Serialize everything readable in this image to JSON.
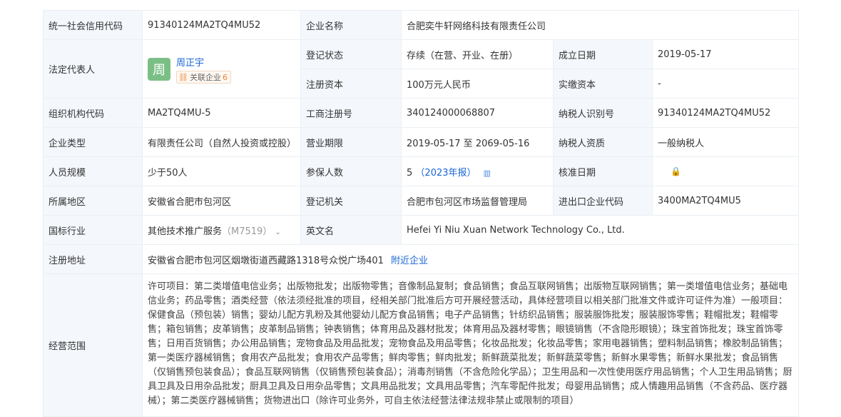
{
  "rows": {
    "credit_code": {
      "label": "统一社会信用代码",
      "value": "91340124MA2TQ4MU52"
    },
    "company_name": {
      "label": "企业名称",
      "value": "合肥奕牛轩网络科技有限责任公司"
    },
    "legal_rep": {
      "label": "法定代表人",
      "avatar_char": "周",
      "name": "周正宇",
      "related_label": "关联企业",
      "related_count": "6"
    },
    "reg_status": {
      "label": "登记状态",
      "value": "存续（在营、开业、在册）"
    },
    "est_date": {
      "label": "成立日期",
      "value": "2019-05-17"
    },
    "reg_capital": {
      "label": "注册资本",
      "value": "100万元人民币"
    },
    "paid_capital": {
      "label": "实缴资本",
      "value": "-"
    },
    "org_code": {
      "label": "组织机构代码",
      "value": "MA2TQ4MU-5"
    },
    "biz_reg_no": {
      "label": "工商注册号",
      "value": "340124000068807"
    },
    "taxpayer_id": {
      "label": "纳税人识别号",
      "value": "91340124MA2TQ4MU52"
    },
    "company_type": {
      "label": "企业类型",
      "value": "有限责任公司（自然人投资或控股）"
    },
    "biz_term": {
      "label": "营业期限",
      "value": "2019-05-17 至 2069-05-16"
    },
    "taxpayer_qual": {
      "label": "纳税人资质",
      "value": "一般纳税人"
    },
    "staff_size": {
      "label": "人员规模",
      "value": "少于50人"
    },
    "insured": {
      "label": "参保人数",
      "value": "5",
      "year": "（2023年报）"
    },
    "approve_date": {
      "label": "核准日期",
      "icon": "lock-icon"
    },
    "region": {
      "label": "所属地区",
      "value": "安徽省合肥市包河区"
    },
    "reg_authority": {
      "label": "登记机关",
      "value": "合肥市包河区市场监督管理局"
    },
    "import_export": {
      "label": "进出口企业代码",
      "value": "3400MA2TQ4MU5"
    },
    "industry": {
      "label": "国标行业",
      "value": "其他技术推广服务",
      "code": "（M7519）"
    },
    "english_name": {
      "label": "英文名",
      "value": "Hefei Yi Niu Xuan Network Technology Co., Ltd."
    },
    "address": {
      "label": "注册地址",
      "value": "安徽省合肥市包河区烟墩街道西藏路1318号众悦广场401",
      "link": "附近企业"
    },
    "scope": {
      "label": "经营范围",
      "value": "许可项目：第二类增值电信业务；出版物批发；出版物零售；音像制品复制；食品销售；食品互联网销售；出版物互联网销售；第一类增值电信业务；基础电信业务；药品零售；酒类经营（依法须经批准的项目，经相关部门批准后方可开展经营活动，具体经营项目以相关部门批准文件或许可证件为准）一般项目：保健食品（预包装）销售；婴幼儿配方乳粉及其他婴幼儿配方食品销售；电子产品销售；针纺织品销售；服装服饰批发；服装服饰零售；鞋帽批发；鞋帽零售；箱包销售；皮革销售；皮革制品销售；钟表销售；体育用品及器材批发；体育用品及器材零售；眼镜销售（不含隐形眼镜）；珠宝首饰批发；珠宝首饰零售；日用百货销售；办公用品销售；宠物食品及用品批发；宠物食品及用品零售；化妆品批发；化妆品零售；家用电器销售；塑料制品销售；橡胶制品销售；第一类医疗器械销售；食用农产品批发；食用农产品零售；鲜肉零售；鲜肉批发；新鲜蔬菜批发；新鲜蔬菜零售；新鲜水果零售；新鲜水果批发；食品销售（仅销售预包装食品）；食品互联网销售（仅销售预包装食品）；消毒剂销售（不含危险化学品）；卫生用品和一次性使用医疗用品销售；个人卫生用品销售；厨具卫具及日用杂品批发；厨具卫具及日用杂品零售；文具用品批发；文具用品零售；汽车零配件批发；母婴用品销售；成人情趣用品销售（不含药品、医疗器械）；第二类医疗器械销售；货物进出口（除许可业务外，可自主依法经营法律法规非禁止或限制的项目）"
    }
  }
}
